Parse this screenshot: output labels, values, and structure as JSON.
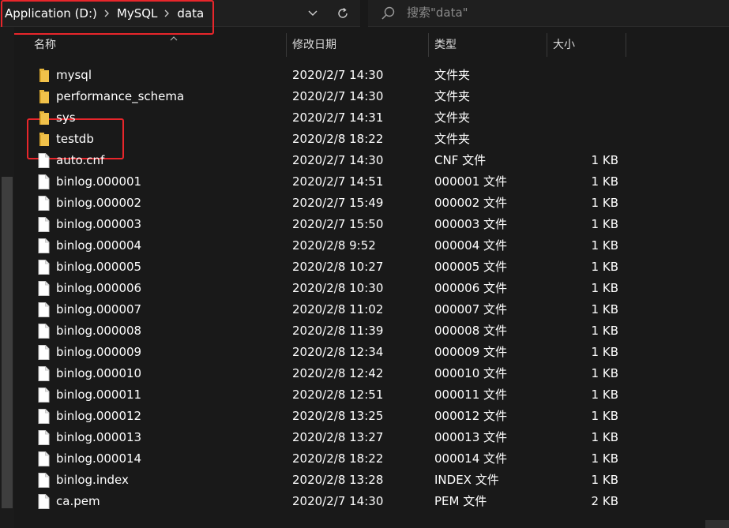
{
  "address_bar": {
    "breadcrumbs": [
      "Application (D:)",
      "MySQL",
      "data"
    ]
  },
  "search": {
    "placeholder": "搜索\"data\""
  },
  "columns": {
    "name": "名称",
    "date": "修改日期",
    "type": "类型",
    "size": "大小"
  },
  "files": [
    {
      "name": "mysql",
      "date": "2020/2/7 14:30",
      "type": "文件夹",
      "size": "",
      "icon": "folder-icon"
    },
    {
      "name": "performance_schema",
      "date": "2020/2/7 14:30",
      "type": "文件夹",
      "size": "",
      "icon": "folder-icon"
    },
    {
      "name": "sys",
      "date": "2020/2/7 14:31",
      "type": "文件夹",
      "size": "",
      "icon": "folder-icon"
    },
    {
      "name": "testdb",
      "date": "2020/2/8 18:22",
      "type": "文件夹",
      "size": "",
      "icon": "folder-icon"
    },
    {
      "name": "auto.cnf",
      "date": "2020/2/7 14:30",
      "type": "CNF 文件",
      "size": "1 KB",
      "icon": "file-icon"
    },
    {
      "name": "binlog.000001",
      "date": "2020/2/7 14:51",
      "type": "000001 文件",
      "size": "1 KB",
      "icon": "file-icon"
    },
    {
      "name": "binlog.000002",
      "date": "2020/2/7 15:49",
      "type": "000002 文件",
      "size": "1 KB",
      "icon": "file-icon"
    },
    {
      "name": "binlog.000003",
      "date": "2020/2/7 15:50",
      "type": "000003 文件",
      "size": "1 KB",
      "icon": "file-icon"
    },
    {
      "name": "binlog.000004",
      "date": "2020/2/8 9:52",
      "type": "000004 文件",
      "size": "1 KB",
      "icon": "file-icon"
    },
    {
      "name": "binlog.000005",
      "date": "2020/2/8 10:27",
      "type": "000005 文件",
      "size": "1 KB",
      "icon": "file-icon"
    },
    {
      "name": "binlog.000006",
      "date": "2020/2/8 10:30",
      "type": "000006 文件",
      "size": "1 KB",
      "icon": "file-icon"
    },
    {
      "name": "binlog.000007",
      "date": "2020/2/8 11:02",
      "type": "000007 文件",
      "size": "1 KB",
      "icon": "file-icon"
    },
    {
      "name": "binlog.000008",
      "date": "2020/2/8 11:39",
      "type": "000008 文件",
      "size": "1 KB",
      "icon": "file-icon"
    },
    {
      "name": "binlog.000009",
      "date": "2020/2/8 12:34",
      "type": "000009 文件",
      "size": "1 KB",
      "icon": "file-icon"
    },
    {
      "name": "binlog.000010",
      "date": "2020/2/8 12:42",
      "type": "000010 文件",
      "size": "1 KB",
      "icon": "file-icon"
    },
    {
      "name": "binlog.000011",
      "date": "2020/2/8 12:51",
      "type": "000011 文件",
      "size": "1 KB",
      "icon": "file-icon"
    },
    {
      "name": "binlog.000012",
      "date": "2020/2/8 13:25",
      "type": "000012 文件",
      "size": "1 KB",
      "icon": "file-icon"
    },
    {
      "name": "binlog.000013",
      "date": "2020/2/8 13:27",
      "type": "000013 文件",
      "size": "1 KB",
      "icon": "file-icon"
    },
    {
      "name": "binlog.000014",
      "date": "2020/2/8 18:22",
      "type": "000014 文件",
      "size": "1 KB",
      "icon": "file-icon"
    },
    {
      "name": "binlog.index",
      "date": "2020/2/8 13:28",
      "type": "INDEX 文件",
      "size": "1 KB",
      "icon": "file-icon"
    },
    {
      "name": "ca.pem",
      "date": "2020/2/7 14:30",
      "type": "PEM 文件",
      "size": "2 KB",
      "icon": "file-icon"
    }
  ],
  "colors": {
    "background": "#191919",
    "text": "#ffffff",
    "highlight_box": "#e8262b",
    "folder": "#f1c14a"
  }
}
